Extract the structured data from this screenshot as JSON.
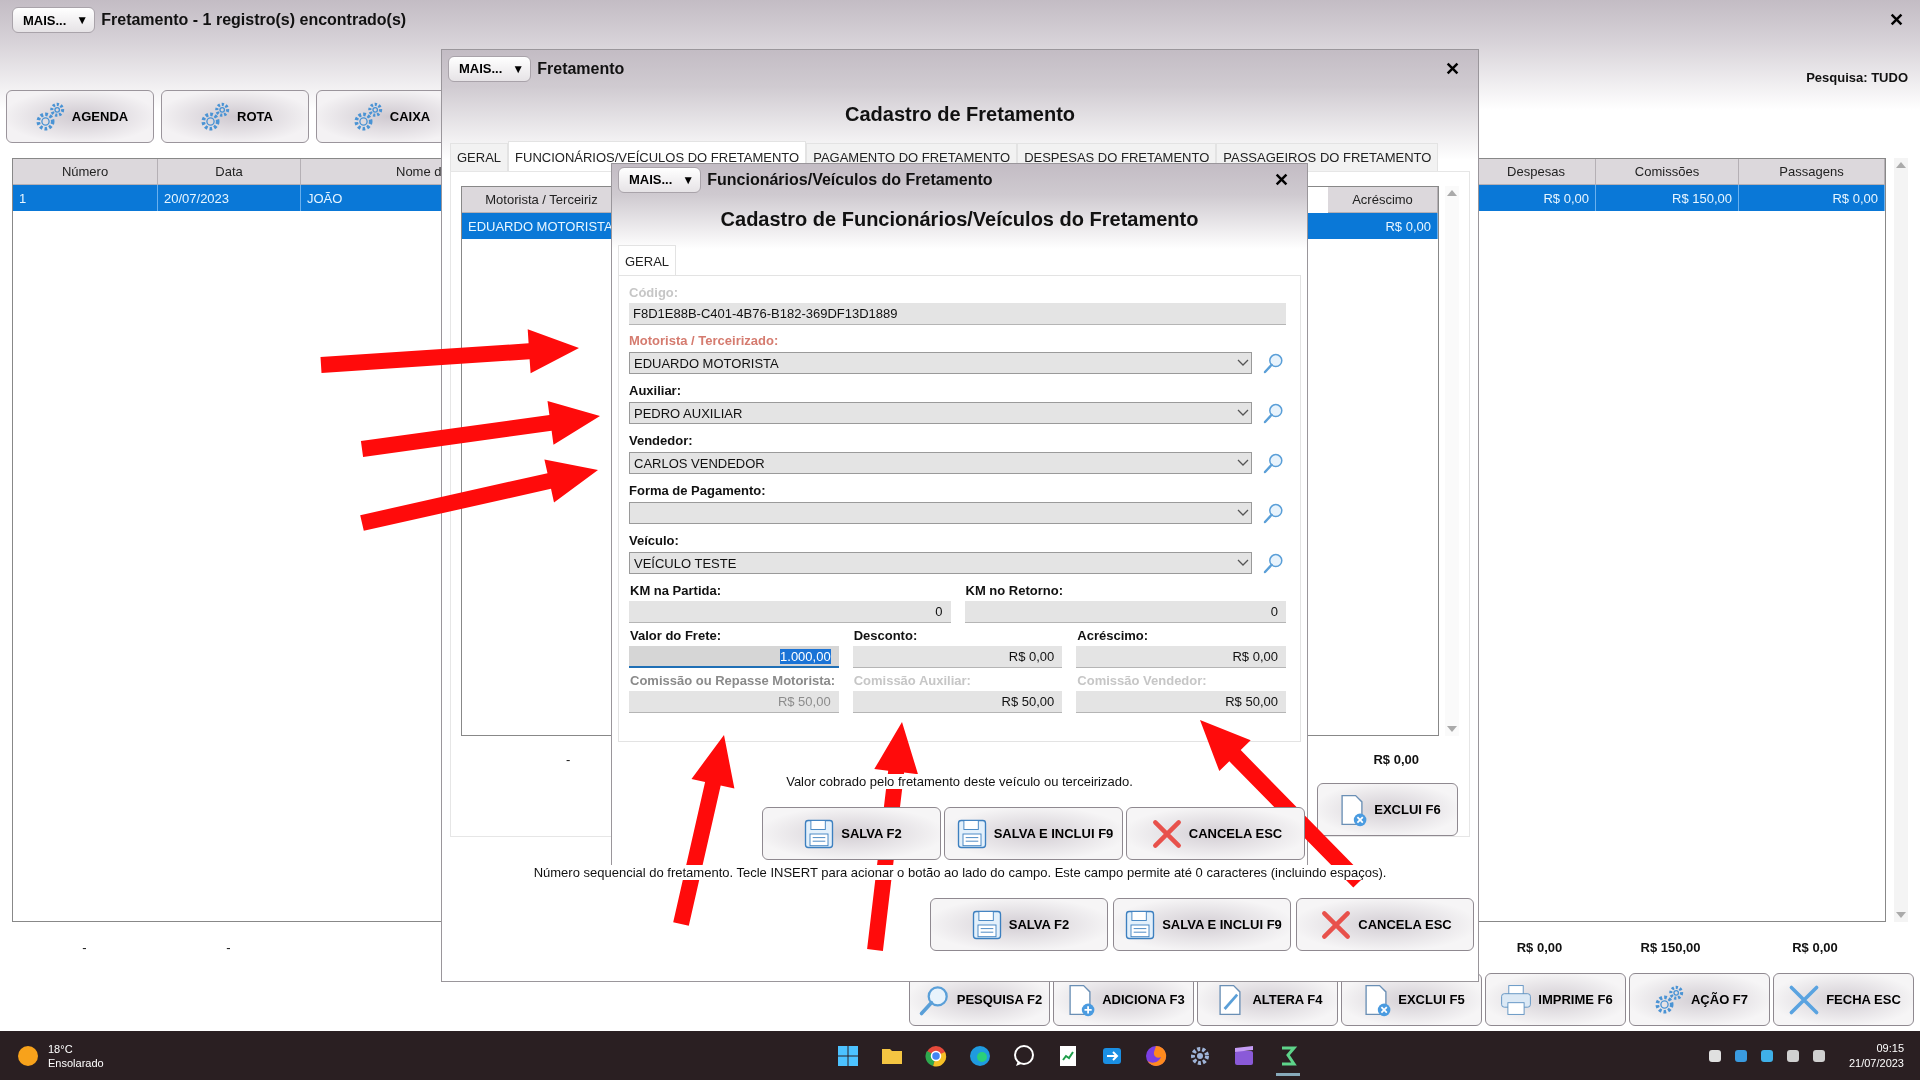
{
  "main_window": {
    "menu_button": "MAIS...",
    "menu_caret": "▼",
    "title": "Fretamento - 1 registro(s) encontrado(s)",
    "close_glyph": "✕",
    "toolbar": [
      {
        "label": "AGENDA"
      },
      {
        "label": "ROTA"
      },
      {
        "label": "CAIXA"
      }
    ],
    "search_scope": "Pesquisa: TUDO",
    "table": {
      "columns": [
        {
          "label": "Número",
          "kind": "text"
        },
        {
          "label": "Data",
          "kind": "text"
        },
        {
          "label": "Nome d",
          "kind": "text"
        },
        {
          "label": "Despesas",
          "kind": "money"
        },
        {
          "label": "Comissões",
          "kind": "money"
        },
        {
          "label": "Passagens",
          "kind": "money"
        }
      ],
      "rows": [
        {
          "selected": true,
          "cells": [
            "1",
            "20/07/2023",
            "JOÃO",
            "R$ 0,00",
            "R$ 150,00",
            "R$ 0,00"
          ]
        }
      ]
    },
    "totals": [
      "-",
      "-",
      "R$ 0,00",
      "R$ 150,00",
      "R$ 0,00"
    ],
    "buttons": [
      {
        "label": "PESQUISA F2",
        "kind": "search"
      },
      {
        "label": "ADICIONA F3",
        "kind": "add"
      },
      {
        "label": "ALTERA F4",
        "kind": "edit"
      },
      {
        "label": "EXCLUI F5",
        "kind": "delete"
      },
      {
        "label": "IMPRIME F6",
        "kind": "print"
      },
      {
        "label": "AÇÃO F7",
        "kind": "gear"
      },
      {
        "label": "FECHA ESC",
        "kind": "close"
      }
    ]
  },
  "fretamento_dialog": {
    "menu_button": "MAIS...",
    "menu_caret": "▼",
    "title": "Fretamento",
    "close_glyph": "✕",
    "heading": "Cadastro de Fretamento",
    "tabs": [
      {
        "label": "GERAL",
        "selected": false
      },
      {
        "label": "FUNCIONÁRIOS/VEÍCULOS DO FRETAMENTO",
        "selected": true
      },
      {
        "label": "PAGAMENTO DO FRETAMENTO",
        "selected": false
      },
      {
        "label": "DESPESAS DO FRETAMENTO",
        "selected": false
      },
      {
        "label": "PASSAGEIROS DO FRETAMENTO",
        "selected": false
      }
    ],
    "table": {
      "columns": [
        {
          "label": "Motorista / Terceiriz",
          "kind": "text"
        },
        {
          "label": "Acréscimo",
          "kind": "money"
        }
      ],
      "rows": [
        {
          "selected": true,
          "cells": [
            "EDUARDO MOTORISTA",
            "R$ 0,00"
          ]
        }
      ]
    },
    "totals": [
      "-",
      "R$ 0,00"
    ],
    "side_buttons": [
      {
        "label": "EXCLUI F6",
        "kind": "delete"
      }
    ],
    "help": "Número sequencial do fretamento. Tecle INSERT para acionar o botão ao lado do campo. Este campo permite até 0 caracteres (incluindo espaços).",
    "buttons": [
      {
        "label": "SALVA F2",
        "kind": "save"
      },
      {
        "label": "SALVA E INCLUI F9",
        "kind": "save"
      },
      {
        "label": "CANCELA ESC",
        "kind": "cancel"
      }
    ]
  },
  "funcionarios_dialog": {
    "menu_button": "MAIS...",
    "menu_caret": "▼",
    "title": "Funcionários/Veículos do Fretamento",
    "close_glyph": "✕",
    "heading": "Cadastro de Funcionários/Veículos do Fretamento",
    "tabs": [
      {
        "label": "GERAL",
        "selected": true
      }
    ],
    "rows": [
      [
        {
          "label": "Código:",
          "kind": "text",
          "value": "F8D1E88B-C401-4B76-B182-369DF13D1889",
          "required": false,
          "disabled": true,
          "readonly": false,
          "focused": false
        }
      ],
      [
        {
          "label": "Motorista / Terceirizado:",
          "kind": "select",
          "value": "EDUARDO MOTORISTA",
          "required": true,
          "disabled": false,
          "readonly": false,
          "focused": false
        }
      ],
      [
        {
          "label": "Auxiliar:",
          "kind": "select",
          "value": "PEDRO AUXILIAR",
          "required": false,
          "disabled": false,
          "readonly": false,
          "focused": false
        }
      ],
      [
        {
          "label": "Vendedor:",
          "kind": "select",
          "value": "CARLOS VENDEDOR",
          "required": false,
          "disabled": false,
          "readonly": false,
          "focused": false
        }
      ],
      [
        {
          "label": "Forma de Pagamento:",
          "kind": "select",
          "required": false,
          "disabled": false,
          "readonly": false,
          "focused": false
        }
      ],
      [
        {
          "label": "Veículo:",
          "kind": "select",
          "value": "VEÍCULO TESTE",
          "required": false,
          "disabled": false,
          "readonly": false,
          "focused": false
        }
      ],
      [
        {
          "label": "KM na Partida:",
          "kind": "number",
          "value": "0",
          "required": false,
          "disabled": false,
          "readonly": false,
          "focused": false
        },
        {
          "label": "KM no Retorno:",
          "kind": "number",
          "value": "0",
          "required": false,
          "disabled": false,
          "readonly": false,
          "focused": false
        }
      ],
      [
        {
          "label": "Valor do Frete:",
          "kind": "number",
          "value": "1.000,00",
          "required": false,
          "disabled": false,
          "readonly": false,
          "focused": true
        },
        {
          "label": "Desconto:",
          "kind": "number",
          "value": "R$ 0,00",
          "required": false,
          "disabled": false,
          "readonly": false,
          "focused": false
        },
        {
          "label": "Acréscimo:",
          "kind": "number",
          "value": "R$ 0,00",
          "required": false,
          "disabled": false,
          "readonly": false,
          "focused": false
        }
      ],
      [
        {
          "label": "Comissão ou Repasse Motorista:",
          "kind": "number",
          "value": "R$ 50,00",
          "required": false,
          "disabled": false,
          "readonly": true,
          "focused": false
        },
        {
          "label": "Comissão Auxiliar:",
          "kind": "number",
          "value": "R$ 50,00",
          "required": false,
          "disabled": true,
          "readonly": false,
          "focused": false
        },
        {
          "label": "Comissão Vendedor:",
          "kind": "number",
          "value": "R$ 50,00",
          "required": false,
          "disabled": true,
          "readonly": false,
          "focused": false
        }
      ]
    ],
    "help": "Valor cobrado pelo fretamento deste veículo ou terceirizado.",
    "buttons": [
      {
        "label": "SALVA F2",
        "kind": "save"
      },
      {
        "label": "SALVA E INCLUI F9",
        "kind": "save"
      },
      {
        "label": "CANCELA ESC",
        "kind": "cancel"
      }
    ]
  },
  "taskbar": {
    "temperature": "18°C",
    "weather": "Ensolarado",
    "time": "09:15",
    "date": "21/07/2023"
  }
}
